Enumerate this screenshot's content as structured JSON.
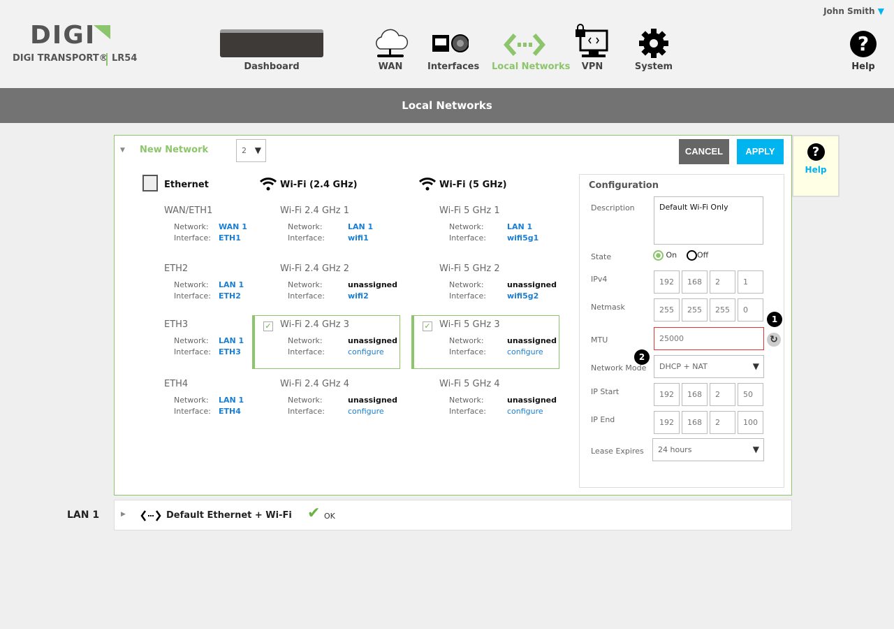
{
  "header": {
    "user": "John Smith",
    "logo": {
      "brand": "DIGI",
      "product": "DIGI TRANSPORT®",
      "model": "LR54"
    },
    "nav": [
      {
        "label": "Dashboard",
        "icon": "router-device-image"
      },
      {
        "label": "WAN",
        "icon": "cloud-icon"
      },
      {
        "label": "Interfaces",
        "icon": "ethernet-port-icon"
      },
      {
        "label": "Local Networks",
        "icon": "local-network-icon",
        "active": true
      },
      {
        "label": "VPN",
        "icon": "vpn-monitor-lock-icon"
      },
      {
        "label": "System",
        "icon": "gear-icon"
      }
    ],
    "help_label": "Help"
  },
  "page_title": "Local Networks",
  "colors": {
    "accent_green": "#8cc56c",
    "apply_blue": "#00b4f0",
    "cancel_gray": "#666666",
    "link_blue": "#1a7fd4",
    "error_red": "#e53333"
  },
  "network_panel": {
    "title": "New Network",
    "number_select": "2",
    "cancel_label": "CANCEL",
    "apply_label": "APPLY",
    "network_label": "Network:",
    "interface_label": "Interface:",
    "columns": [
      {
        "title": "Ethernet",
        "icon": "ethernet-icon",
        "items": [
          {
            "name": "WAN/ETH1",
            "network": "WAN 1",
            "interface": "ETH1"
          },
          {
            "name": "ETH2",
            "network": "LAN 1",
            "interface": "ETH2"
          },
          {
            "name": "ETH3",
            "network": "LAN 1",
            "interface": "ETH3"
          },
          {
            "name": "ETH4",
            "network": "LAN 1",
            "interface": "ETH4"
          }
        ]
      },
      {
        "title": "Wi-Fi (2.4 GHz)",
        "icon": "wifi-icon",
        "items": [
          {
            "name": "Wi-Fi 2.4 GHz 1",
            "network": "LAN 1",
            "interface": "wifi1"
          },
          {
            "name": "Wi-Fi 2.4 GHz 2",
            "network": "unassigned",
            "interface": "wifi2",
            "checked": true
          },
          {
            "name": "Wi-Fi 2.4 GHz  3",
            "network": "unassigned",
            "interface": "configure"
          },
          {
            "name": "Wi-Fi 2.4 GHz  4",
            "network": "unassigned",
            "interface": "configure"
          }
        ]
      },
      {
        "title": "Wi-Fi (5 GHz)",
        "icon": "wifi-icon",
        "items": [
          {
            "name": "Wi-Fi 5 GHz 1",
            "network": "LAN 1",
            "interface": "wifi5g1"
          },
          {
            "name": "Wi-Fi 5 GHz 2",
            "network": "unassigned",
            "interface": "wifi5g2",
            "checked": true
          },
          {
            "name": "Wi-Fi 5 GHz  3",
            "network": "unassigned",
            "interface": "configure"
          },
          {
            "name": "Wi-Fi 5 GHz  4",
            "network": "unassigned",
            "interface": "configure"
          }
        ]
      }
    ],
    "config": {
      "title": "Configuration",
      "description_label": "Description",
      "description": "Default Wi-Fi Only",
      "state_label": "State",
      "state_on": "On",
      "state_off": "Off",
      "state_value": "On",
      "ipv4_label": "IPv4",
      "ipv4": [
        "192",
        "168",
        "2",
        "1"
      ],
      "netmask_label": "Netmask",
      "netmask": [
        "255",
        "255",
        "255",
        "0"
      ],
      "mtu_label": "MTU",
      "mtu": "25000",
      "network_mode_label": "Network Mode",
      "network_mode": "DHCP + NAT",
      "ip_start_label": "IP Start",
      "ip_start": [
        "192",
        "168",
        "2",
        "50"
      ],
      "ip_end_label": "IP End",
      "ip_end": [
        "192",
        "168",
        "2",
        "100"
      ],
      "lease_label": "Lease Expires",
      "lease": "24 hours",
      "badge1": "1",
      "badge2": "2"
    }
  },
  "help_panel": {
    "label": "Help"
  },
  "lan_row": {
    "name": "LAN 1",
    "description": "Default Ethernet + Wi-Fi",
    "status": "OK"
  }
}
